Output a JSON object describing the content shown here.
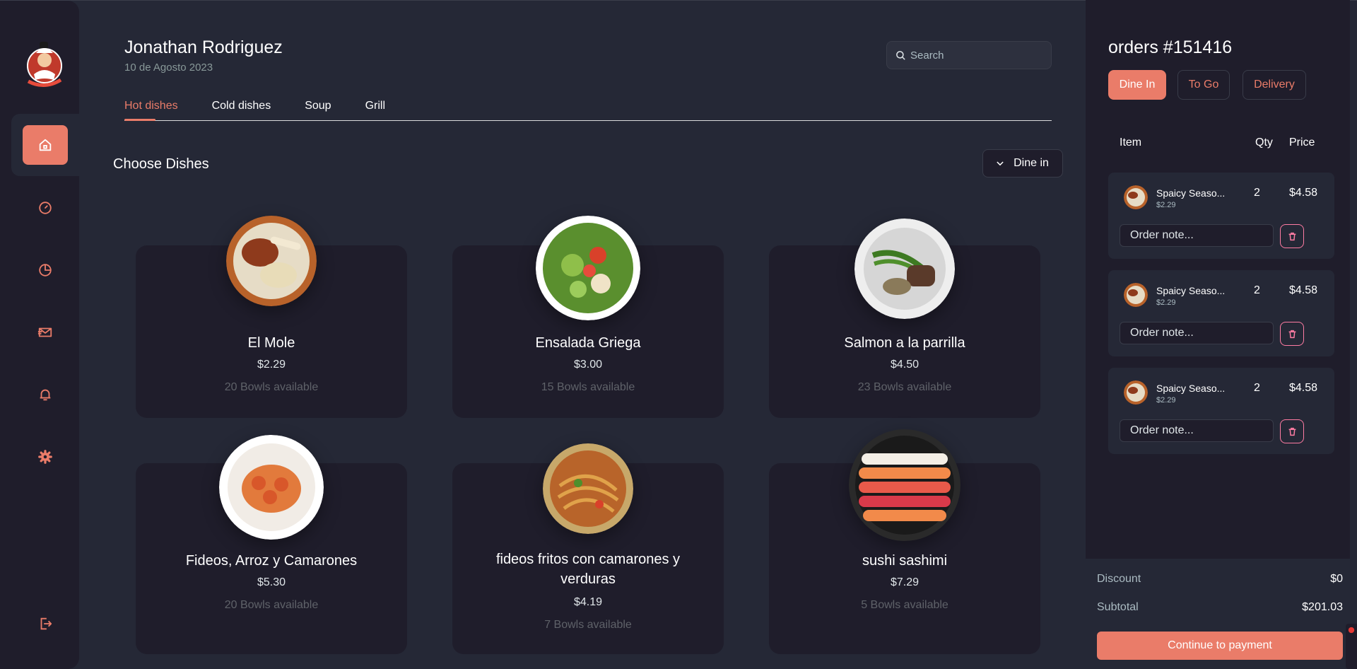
{
  "user": {
    "name": "Jonathan Rodriguez",
    "date": "10 de Agosto 2023"
  },
  "search": {
    "placeholder": "Search"
  },
  "tabs": [
    {
      "label": "Hot dishes"
    },
    {
      "label": "Cold dishes"
    },
    {
      "label": "Soup"
    },
    {
      "label": "Grill"
    }
  ],
  "section": {
    "title": "Choose Dishes",
    "dine_option": "Dine in"
  },
  "dishes": [
    {
      "name": "El Mole",
      "price": "$2.29",
      "availability": "20 Bowls available"
    },
    {
      "name": "Ensalada Griega",
      "price": "$3.00",
      "availability": "15 Bowls available"
    },
    {
      "name": "Salmon a la parrilla",
      "price": "$4.50",
      "availability": "23 Bowls available"
    },
    {
      "name": "Fideos, Arroz y Camarones",
      "price": "$5.30",
      "availability": "20 Bowls available"
    },
    {
      "name": "fideos fritos con camarones y verduras",
      "price": "$4.19",
      "availability": "7 Bowls available"
    },
    {
      "name": "sushi sashimi",
      "price": "$7.29",
      "availability": "5 Bowls available"
    }
  ],
  "order": {
    "title": "orders #151416",
    "types": [
      {
        "label": "Dine In"
      },
      {
        "label": "To Go"
      },
      {
        "label": "Delivery"
      }
    ],
    "columns": {
      "item": "Item",
      "qty": "Qty",
      "price": "Price"
    },
    "items": [
      {
        "name": "Spaicy Seaso...",
        "unit_price": "$2.29",
        "qty": "2",
        "total": "$4.58",
        "note_placeholder": "Order note..."
      },
      {
        "name": "Spaicy Seaso...",
        "unit_price": "$2.29",
        "qty": "2",
        "total": "$4.58",
        "note_placeholder": "Order note..."
      },
      {
        "name": "Spaicy Seaso...",
        "unit_price": "$2.29",
        "qty": "2",
        "total": "$4.58",
        "note_placeholder": "Order note..."
      }
    ],
    "discount_label": "Discount",
    "discount_value": "$0",
    "subtotal_label": "Subtotal",
    "subtotal_value": "$201.03",
    "pay_label": "Continue to payment"
  },
  "colors": {
    "accent": "#ea7c69",
    "panel": "#1f1d2b",
    "background": "#252836"
  }
}
